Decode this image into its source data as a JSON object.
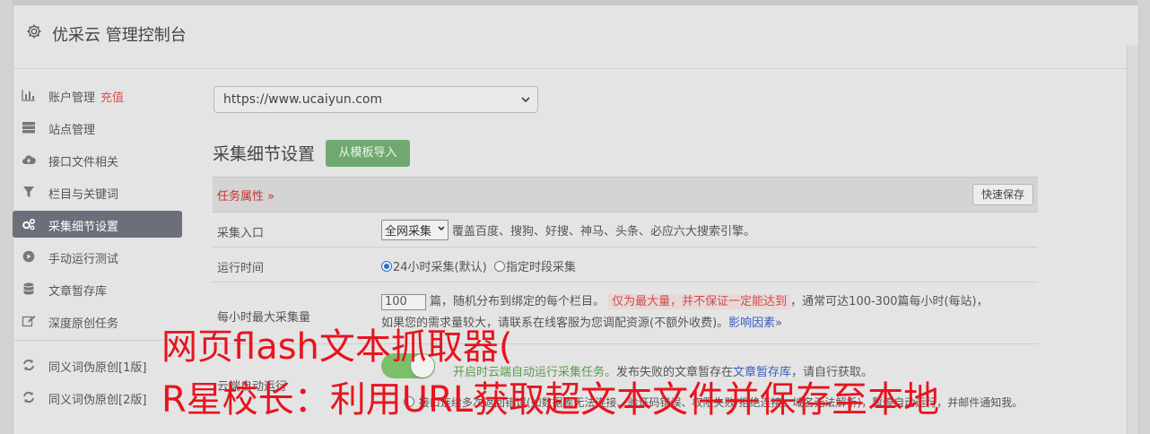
{
  "header": {
    "title": "优采云 管理控制台"
  },
  "sidebar": {
    "items": [
      {
        "label": "账户管理",
        "extra": "充值",
        "icon": "bar-chart-icon"
      },
      {
        "label": "站点管理",
        "icon": "server-icon"
      },
      {
        "label": "接口文件相关",
        "icon": "cloud-upload-icon"
      },
      {
        "label": "栏目与关键词",
        "icon": "filter-icon"
      },
      {
        "label": "采集细节设置",
        "icon": "gears-icon",
        "active": true
      },
      {
        "label": "手动运行测试",
        "icon": "play-circle-icon"
      },
      {
        "label": "文章暂存库",
        "icon": "database-icon"
      },
      {
        "label": "深度原创任务",
        "icon": "edit-icon"
      }
    ],
    "items2": [
      {
        "label": "同义词伪原创[1版]",
        "icon": "refresh-icon"
      },
      {
        "label": "同义词伪原创[2版]",
        "icon": "refresh-icon"
      }
    ]
  },
  "main": {
    "url_select": "https://www.ucaiyun.com",
    "section_title": "采集细节设置",
    "import_button": "从模板导入",
    "table_header": "任务属性 »",
    "save_button": "快速保存",
    "rows": {
      "entry": {
        "label": "采集入口",
        "select": "全网采集",
        "desc": "覆盖百度、搜狗、好搜、神马、头条、必应六大搜索引擎。"
      },
      "runtime": {
        "label": "运行时间",
        "opt1": "24小时采集(默认)",
        "opt2": "指定时段采集"
      },
      "max": {
        "label": "每小时最大采集量",
        "value": "100",
        "text1": "篇，随机分布到绑定的每个栏目。",
        "highlight": "仅为最大量，并不保证一定能达到",
        "text2": "，通常可达100-300篇每小时(每站)，",
        "text3": "如果您的需求量较大，请联系在线客服为您调配资源(不额外收费)。",
        "link": "影响因素»"
      },
      "auto": {
        "label": "云端自动运行",
        "desc_green": "开启时云端自动运行采集任务。",
        "desc1": "发布失败的文章暂存在",
        "desc_link": "文章暂存库",
        "desc2": "，请自行获取。",
        "desc3": "接口连续多次返回错误(如数据库无法连接、验证码错误、权限失败/拒绝连接、域名无法解析)，暂停自动运行，并邮件通知我。"
      }
    }
  },
  "overlay": {
    "line1": "网页flash文本抓取器(",
    "line2": "R星校长：利用URL获取超文本文件并保存至本地"
  },
  "colors": {
    "accent": "#6b6f7a",
    "import_green": "#6fa96f",
    "overlay_red": "#e8141e",
    "highlight_red": "#d24b4b"
  }
}
